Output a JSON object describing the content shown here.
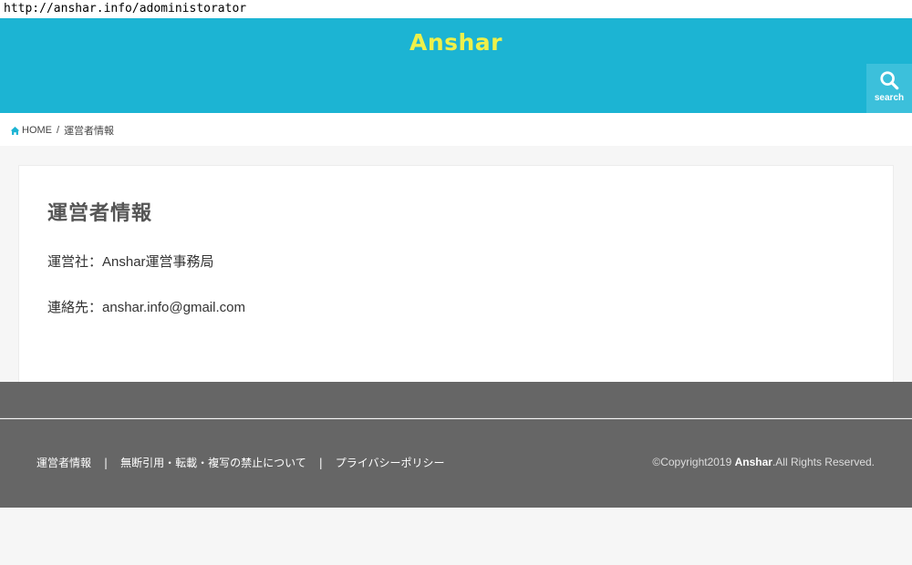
{
  "address_bar": {
    "url": "http://anshar.info/adoministorator"
  },
  "header": {
    "site_title": "Anshar",
    "search_label": "search",
    "colors": {
      "background": "#1cb4d3",
      "title": "#eef04a"
    }
  },
  "breadcrumb": {
    "home": "HOME",
    "separator": "/",
    "current": "運営者情報"
  },
  "main": {
    "title": "運営者情報",
    "operator_label": "運営社：",
    "operator_value": "Anshar運営事務局",
    "contact_label": "連絡先：",
    "contact_value": "anshar.info@gmail.com"
  },
  "footer": {
    "links": [
      "運営者情報",
      "無断引用・転載・複写の禁止について",
      "プライバシーポリシー"
    ],
    "divider": "|",
    "copyright_prefix": "©Copyright2019 ",
    "copyright_brand": "Anshar",
    "copyright_suffix": ".All Rights Reserved.",
    "colors": {
      "background": "#666666"
    }
  }
}
